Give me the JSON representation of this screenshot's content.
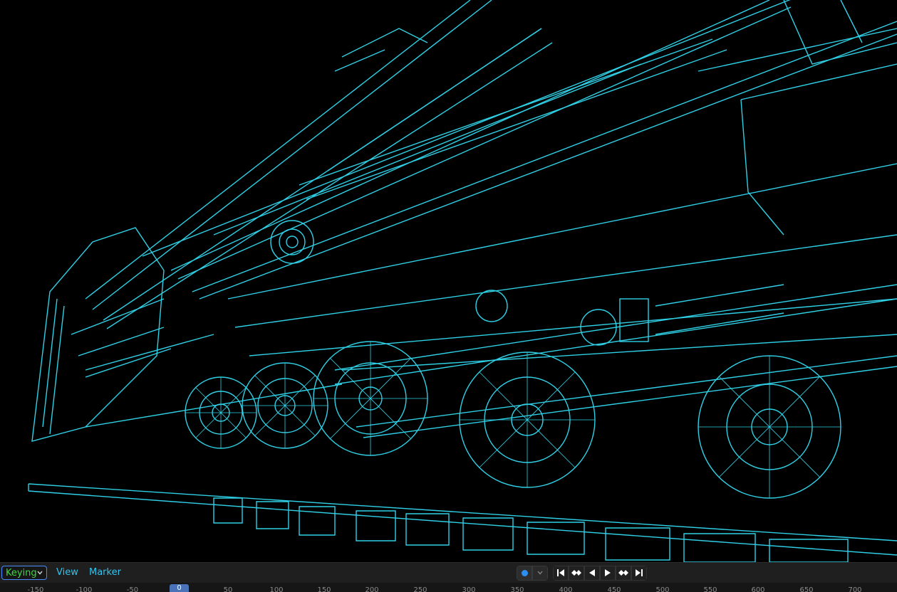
{
  "header": {
    "keying_label": "Keying",
    "view_label": "View",
    "marker_label": "Marker"
  },
  "playback": {
    "icons": [
      "record-dot-icon",
      "dropdown-chevron-icon",
      "jump-to-start-icon",
      "prev-keyframe-icon",
      "play-reverse-icon",
      "play-icon",
      "next-keyframe-icon",
      "jump-to-end-icon"
    ]
  },
  "ruler": {
    "current_frame": "0",
    "ticks": [
      {
        "label": "-150",
        "pos": "50"
      },
      {
        "label": "-100",
        "pos": "118"
      },
      {
        "label": "-50",
        "pos": "186"
      },
      {
        "label": "50",
        "pos": "320"
      },
      {
        "label": "100",
        "pos": "388"
      },
      {
        "label": "150",
        "pos": "455"
      },
      {
        "label": "200",
        "pos": "522"
      },
      {
        "label": "250",
        "pos": "590"
      },
      {
        "label": "300",
        "pos": "658"
      },
      {
        "label": "350",
        "pos": "726"
      },
      {
        "label": "400",
        "pos": "794"
      },
      {
        "label": "450",
        "pos": "862"
      },
      {
        "label": "500",
        "pos": "930"
      },
      {
        "label": "550",
        "pos": "997"
      },
      {
        "label": "600",
        "pos": "1064"
      },
      {
        "label": "650",
        "pos": "1132"
      },
      {
        "label": "700",
        "pos": "1200"
      }
    ]
  },
  "colors": {
    "wire": "#2fd0e6",
    "accent": "#4a72b8",
    "keying_text": "#3fd83f",
    "menu_text": "#31c5ef"
  }
}
